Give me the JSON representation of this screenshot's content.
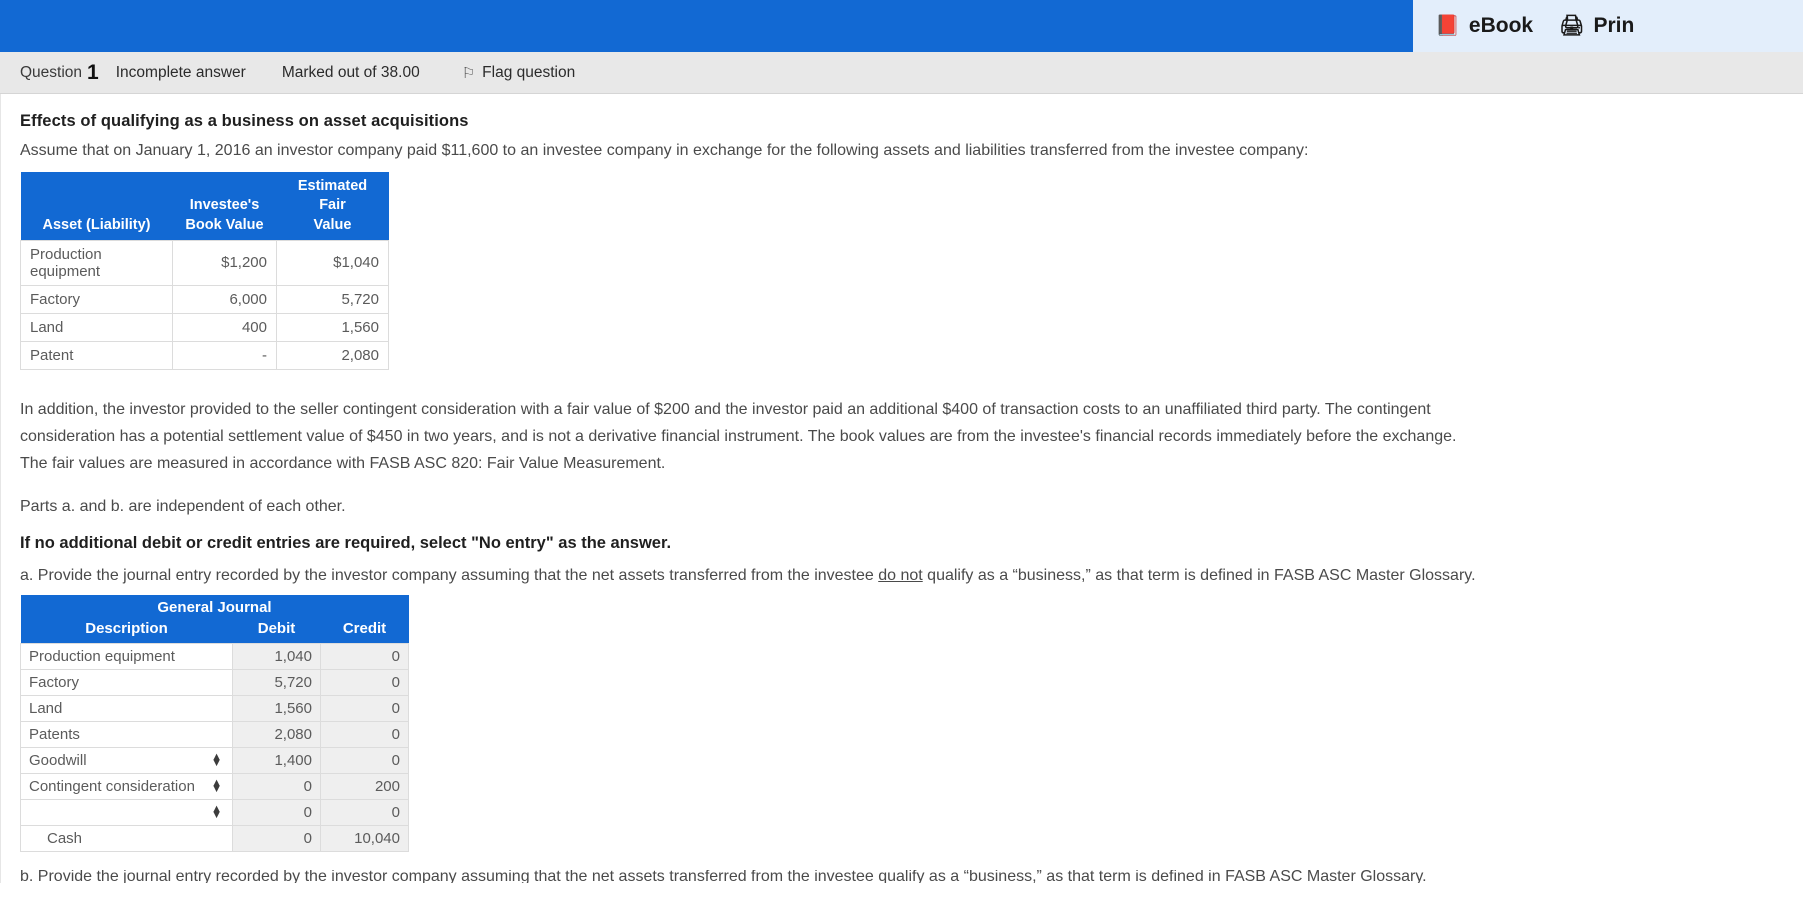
{
  "toolbar": {
    "ebook_label": "eBook",
    "ebook_icon": "book-icon",
    "print_label": "Prin",
    "print_icon": "printer-icon",
    "bar_color": "#1269d3",
    "panel_color": "#e3eefb"
  },
  "question_strip": {
    "question_word": "Question",
    "question_number": "1",
    "state": "Incomplete answer",
    "marks": "Marked out of 38.00",
    "flag_label": "Flag question",
    "flag_icon": "flag-icon"
  },
  "question": {
    "title": "Effects of qualifying as a business on asset acquisitions",
    "intro": "Assume that on January 1, 2016 an investor company paid $11,600 to an investee company in exchange for the following assets and liabilities transferred from the investee company:",
    "para_line_1": "In addition, the investor provided to the seller contingent consideration with a fair value of $200 and the investor paid an additional $400 of transaction costs to an unaffiliated third party. The contingent",
    "para_line_2": "consideration has a potential settlement value of $450 in two years, and is not a derivative financial instrument. The book values are from the investee's financial records immediately before the exchange.",
    "para_line_3": "The fair values are measured in accordance with FASB ASC 820: Fair Value Measurement.",
    "independence_note": "Parts a. and b. are independent of each other.",
    "no_entry_note": "If no additional debit or credit entries are required, select \"No entry\" as the answer.",
    "part_a_pre": "a. Provide the journal entry recorded by the investor company assuming that the net assets transferred from the investee ",
    "part_a_emph": "do not",
    "part_a_post": " qualify as a “business,” as that term is defined in FASB ASC Master Glossary.",
    "part_b_cut": "b. Provide the journal entry recorded by the investor company assuming that the net assets transferred from the investee qualify as a “business,” as that term is defined in FASB ASC Master Glossary."
  },
  "facts_table": {
    "headers": {
      "asset": "Asset (Liability)",
      "book_value_l1": "Investee's",
      "book_value_l2": "Book Value",
      "fair_value_l1": "Estimated Fair",
      "fair_value_l2": "Value"
    },
    "rows": [
      {
        "asset": "Production equipment",
        "book_value": "$1,200",
        "fair_value": "$1,040"
      },
      {
        "asset": "Factory",
        "book_value": "6,000",
        "fair_value": "5,720"
      },
      {
        "asset": "Land",
        "book_value": "400",
        "fair_value": "1,560"
      },
      {
        "asset": "Patent",
        "book_value": "-",
        "fair_value": "2,080"
      }
    ]
  },
  "journal_table": {
    "title": "General Journal",
    "headers": {
      "description": "Description",
      "debit": "Debit",
      "credit": "Credit"
    },
    "rows": [
      {
        "description": "Production equipment",
        "debit": "1,040",
        "credit": "0",
        "is_select": false,
        "indented": false
      },
      {
        "description": "Factory",
        "debit": "5,720",
        "credit": "0",
        "is_select": false,
        "indented": false
      },
      {
        "description": "Land",
        "debit": "1,560",
        "credit": "0",
        "is_select": false,
        "indented": false
      },
      {
        "description": "Patents",
        "debit": "2,080",
        "credit": "0",
        "is_select": false,
        "indented": false
      },
      {
        "description": "Goodwill",
        "debit": "1,400",
        "credit": "0",
        "is_select": true,
        "indented": false
      },
      {
        "description": "Contingent consideration",
        "debit": "0",
        "credit": "200",
        "is_select": true,
        "indented": false
      },
      {
        "description": "",
        "debit": "0",
        "credit": "0",
        "is_select": true,
        "indented": false
      },
      {
        "description": "Cash",
        "debit": "0",
        "credit": "10,040",
        "is_select": false,
        "indented": true
      }
    ]
  }
}
